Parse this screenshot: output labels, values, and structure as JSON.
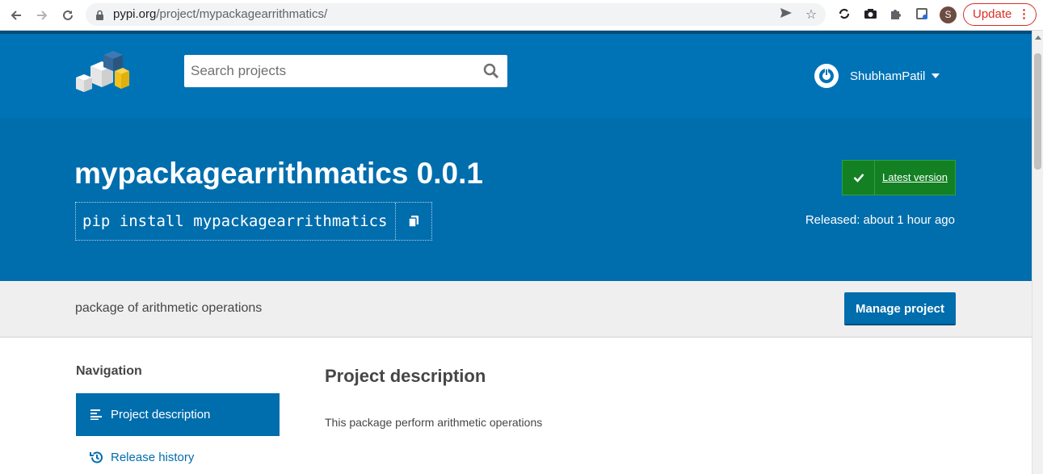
{
  "browser": {
    "url_host": "pypi.org",
    "url_path": "/project/mypackagearrithmatics/",
    "profile_initial": "S",
    "update_label": "Update",
    "update_menu": "⋮"
  },
  "header": {
    "search_placeholder": "Search projects",
    "username": "ShubhamPatil"
  },
  "banner": {
    "title": "mypackagearrithmatics 0.0.1",
    "pip_command": "pip install mypackagearrithmatics",
    "latest_label": "Latest version",
    "released": "Released: about 1 hour ago"
  },
  "summary": {
    "text": "package of arithmetic operations",
    "manage_label": "Manage project"
  },
  "sidebar": {
    "heading": "Navigation",
    "items": [
      {
        "label": "Project description",
        "active": true
      },
      {
        "label": "Release history",
        "active": false
      }
    ]
  },
  "main": {
    "heading": "Project description",
    "body": "This package perform arithmetic operations"
  },
  "colors": {
    "header_blue": "#0073b7",
    "banner_blue": "#006dad",
    "latest_green": "#148024",
    "update_red": "#d93025"
  }
}
